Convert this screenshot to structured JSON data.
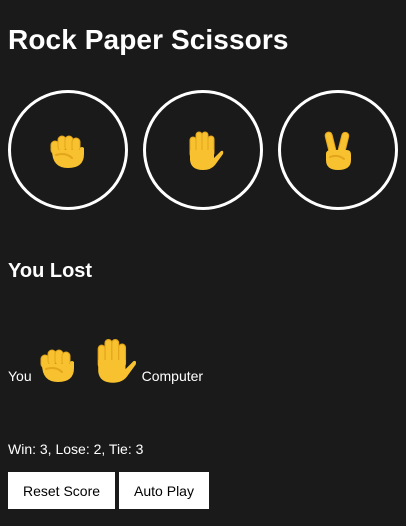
{
  "title": "Rock Paper Scissors",
  "choices": [
    {
      "name": "rock",
      "icon": "fist-emoji"
    },
    {
      "name": "paper",
      "icon": "raised-hand-emoji"
    },
    {
      "name": "scissors",
      "icon": "victory-hand-emoji"
    }
  ],
  "result": "You Lost",
  "moves": {
    "you_label": "You",
    "you_icon": "fist-emoji",
    "computer_icon": "raised-hand-emoji",
    "computer_label": "Computer"
  },
  "score_text": "Win: 3, Lose: 2, Tie: 3",
  "buttons": {
    "reset": "Reset Score",
    "auto": "Auto Play"
  },
  "colors": {
    "background": "#1a1a1a",
    "emoji_fill": "#f7c12f",
    "emoji_shade": "#e3a51b",
    "text": "#ffffff"
  }
}
